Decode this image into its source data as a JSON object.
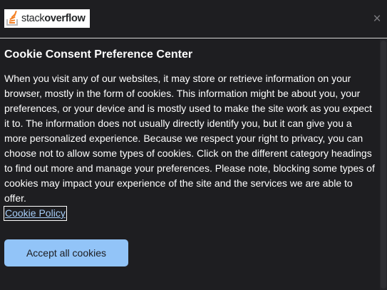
{
  "header": {
    "logo_text_1": "stack",
    "logo_text_2": "overflow",
    "close_label": "×"
  },
  "dialog": {
    "title": "Cookie Consent Preference Center",
    "description": "When you visit any of our websites, it may store or retrieve information on your browser, mostly in the form of cookies. This information might be about you, your preferences, or your device and is mostly used to make the site work as you expect it to. The information does not usually directly identify you, but it can give you a more personalized experience. Because we respect your right to privacy, you can choose not to allow some types of cookies. Click on the different category headings to find out more and manage your preferences. Please note, blocking some types of cookies may impact your experience of the site and the services we are able to offer.",
    "policy_link": "Cookie Policy",
    "accept_button": "Accept all cookies"
  },
  "colors": {
    "background": "#1e1e21",
    "accent_button": "#92c4f8",
    "link": "#a6cdf8",
    "brand_orange": "#f48024"
  },
  "icons": [
    "stack-overflow-logo-icon",
    "close-icon"
  ]
}
